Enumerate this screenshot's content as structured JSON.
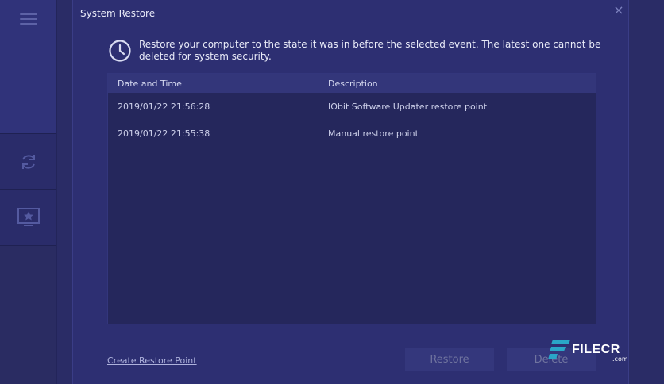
{
  "dialog": {
    "title": "System Restore",
    "close_glyph": "×",
    "info_text": "Restore your computer to the state it was in before the selected event. The latest one cannot be deleted for system security."
  },
  "table": {
    "columns": [
      "Date and Time",
      "Description"
    ],
    "rows": [
      {
        "date": "2019/01/22 21:56:28",
        "description": "IObit Software Updater restore point"
      },
      {
        "date": "2019/01/22 21:55:38",
        "description": "Manual restore point"
      }
    ]
  },
  "footer": {
    "create_link": "Create Restore Point",
    "restore_label": "Restore",
    "delete_label": "Delete"
  },
  "watermark": {
    "text": "FILECR",
    "suffix": ".com"
  },
  "sidebar": {
    "icons": [
      "menu-icon",
      "sync-icon",
      "star-screen-icon"
    ]
  },
  "colors": {
    "background": "#2a2c66",
    "dialog": "#2d2f72",
    "table_body": "#25275c",
    "table_header": "#33367a",
    "button": "#34377c",
    "watermark_accent": "#2aa6c8"
  }
}
